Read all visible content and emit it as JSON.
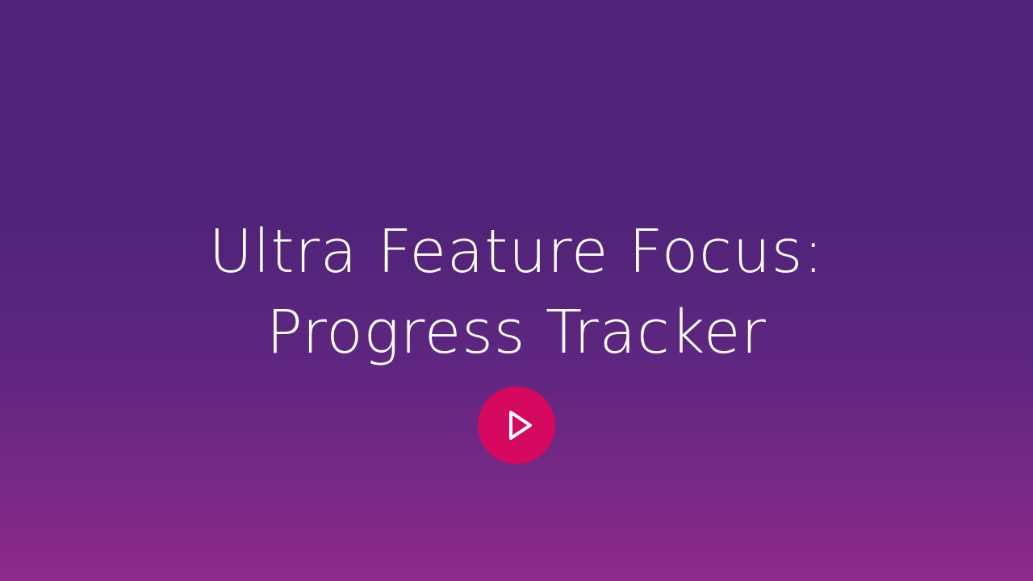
{
  "video": {
    "title_line_1": "Ultra Feature Focus:",
    "title_line_2": "Progress Tracker",
    "play_icon": "play-icon"
  },
  "colors": {
    "background_top": "#4f2378",
    "background_bottom": "#8e2a8c",
    "play_button": "#d4095f",
    "text": "#ffffff"
  }
}
